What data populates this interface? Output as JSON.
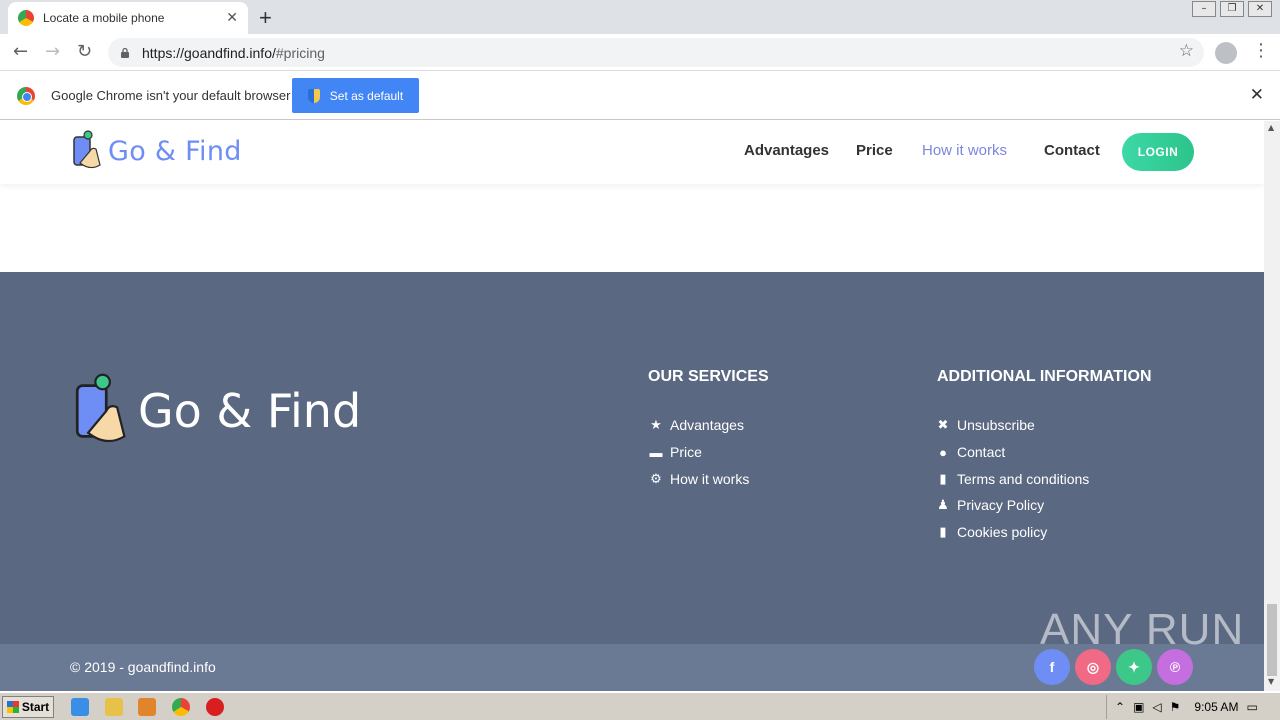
{
  "browser": {
    "tab_title": "Locate a mobile phone",
    "url_host": "https://goandfind.info/",
    "url_path": "#pricing",
    "infobar_message": "Google Chrome isn't your default browser",
    "set_default_label": "Set as default"
  },
  "site": {
    "brand": "Go & Find",
    "nav": [
      "Advantages",
      "Price",
      "How it works",
      "Contact"
    ],
    "login_label": "LOGIN",
    "footer": {
      "services_title": "OUR SERVICES",
      "services": [
        "Advantages",
        "Price",
        "How it works"
      ],
      "info_title": "ADDITIONAL INFORMATION",
      "info": [
        "Unsubscribe",
        "Contact",
        "Terms and conditions",
        "Privacy Policy",
        "Cookies policy"
      ],
      "copyright": "© 2019 - goandfind.info"
    },
    "social": [
      {
        "name": "facebook",
        "glyph": "f",
        "color": "#6f8ef5"
      },
      {
        "name": "instagram",
        "glyph": "◎",
        "color": "#f06a85"
      },
      {
        "name": "twitter",
        "glyph": "✦",
        "color": "#3dc88a"
      },
      {
        "name": "pinterest",
        "glyph": "℗",
        "color": "#c46ee0"
      }
    ]
  },
  "watermark": "ANY RUN",
  "taskbar": {
    "start_label": "Start",
    "clock": "9:05 AM"
  },
  "colors": {
    "footer_bg": "#5a6881",
    "bottom_bar": "#6b7a94",
    "brand_blue": "#6f8ef5",
    "login_green": "#2bc48a",
    "active_nav": "#7b86e0"
  }
}
